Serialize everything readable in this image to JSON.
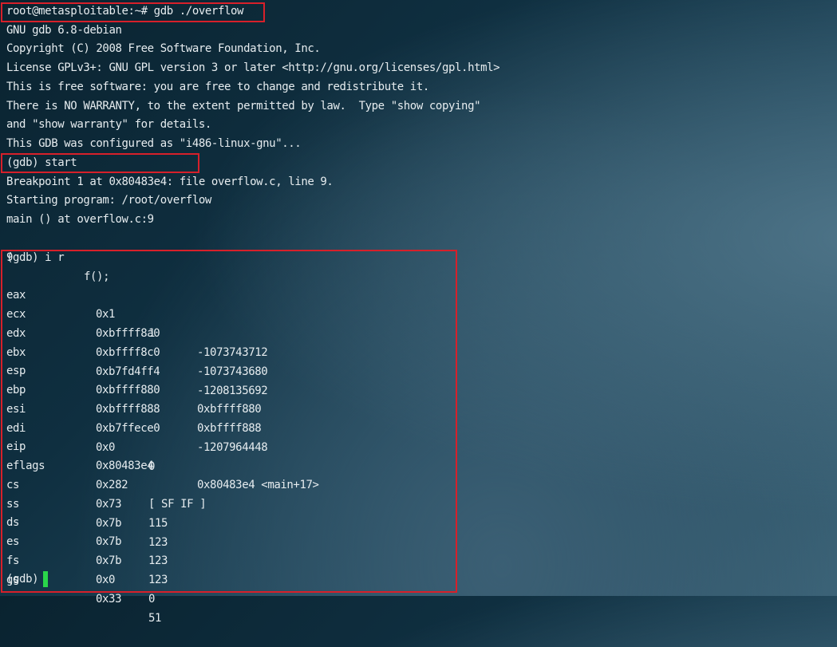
{
  "terminal": {
    "command_line": "root@metasploitable:~# gdb ./overflow",
    "banner": [
      "GNU gdb 6.8-debian",
      "Copyright (C) 2008 Free Software Foundation, Inc.",
      "License GPLv3+: GNU GPL version 3 or later <http://gnu.org/licenses/gpl.html>",
      "This is free software: you are free to change and redistribute it.",
      "There is NO WARRANTY, to the extent permitted by law.  Type \"show copying\"",
      "and \"show warranty\" for details.",
      "This GDB was configured as \"i486-linux-gnu\"..."
    ],
    "start_command": "(gdb) start",
    "start_output": [
      "Breakpoint 1 at 0x80483e4: file overflow.c, line 9.",
      "Starting program: /root/overflow",
      "main () at overflow.c:9"
    ],
    "source_line": {
      "number": "9",
      "code": "f();"
    },
    "info_command": "(gdb) i r",
    "registers": [
      {
        "name": "eax",
        "hex": "0x1",
        "value": "1"
      },
      {
        "name": "ecx",
        "hex": "0xbffff8a0",
        "value": "-1073743712"
      },
      {
        "name": "edx",
        "hex": "0xbffff8c0",
        "value": "-1073743680"
      },
      {
        "name": "ebx",
        "hex": "0xb7fd4ff4",
        "value": "-1208135692"
      },
      {
        "name": "esp",
        "hex": "0xbffff880",
        "value": "0xbffff880"
      },
      {
        "name": "ebp",
        "hex": "0xbffff888",
        "value": "0xbffff888"
      },
      {
        "name": "esi",
        "hex": "0xb7ffece0",
        "value": "-1207964448"
      },
      {
        "name": "edi",
        "hex": "0x0",
        "value": "0"
      },
      {
        "name": "eip",
        "hex": "0x80483e4",
        "value": "0x80483e4 <main+17>"
      },
      {
        "name": "eflags",
        "hex": "0x282",
        "value": "[ SF IF ]"
      },
      {
        "name": "cs",
        "hex": "0x73",
        "value": "115"
      },
      {
        "name": "ss",
        "hex": "0x7b",
        "value": "123"
      },
      {
        "name": "ds",
        "hex": "0x7b",
        "value": "123"
      },
      {
        "name": "es",
        "hex": "0x7b",
        "value": "123"
      },
      {
        "name": "fs",
        "hex": "0x0",
        "value": "0"
      },
      {
        "name": "gs",
        "hex": "0x33",
        "value": "51"
      }
    ],
    "final_prompt": "(gdb)"
  },
  "colors": {
    "text": "#e6ecef",
    "highlight_border": "#d7202a",
    "cursor": "#2ad64a"
  }
}
